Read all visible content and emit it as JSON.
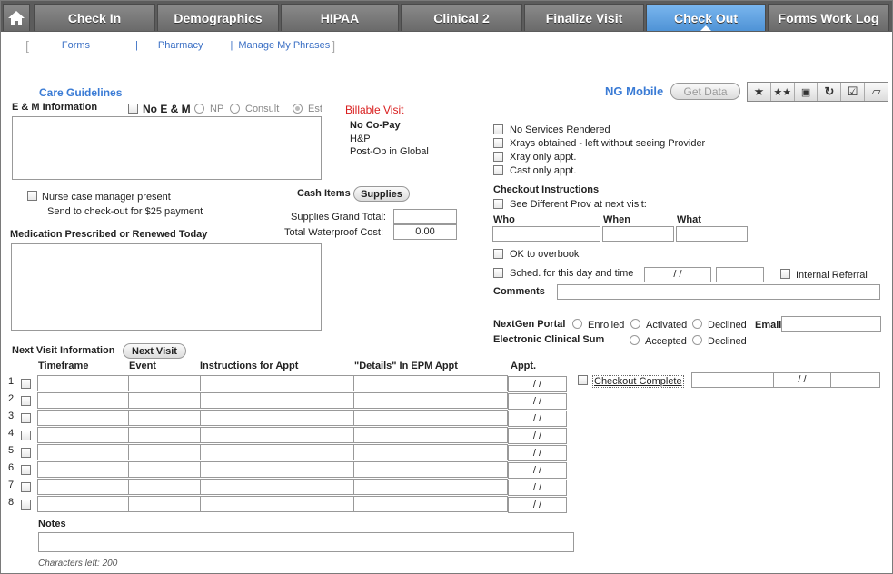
{
  "tabs": {
    "home_icon": "home-icon",
    "items": [
      "Check In",
      "Demographics",
      "HIPAA",
      "Clinical 2",
      "Finalize Visit",
      "Check Out",
      "Forms Work Log"
    ],
    "active": "Check Out"
  },
  "sublinks": [
    "Forms",
    "Pharmacy",
    "Manage My Phrases"
  ],
  "care_guidelines": "Care Guidelines",
  "em": {
    "title": "E & M Information",
    "no_em": "No E & M",
    "np": "NP",
    "consult": "Consult",
    "est": "Est"
  },
  "billable": {
    "title": "Billable Visit",
    "no_copay": "No Co-Pay",
    "hp": "H&P",
    "postop": "Post-Op in Global"
  },
  "nurse": {
    "label": "Nurse case manager present",
    "note": "Send to check-out for $25 payment"
  },
  "cash": {
    "label": "Cash Items",
    "supplies_btn": "Supplies",
    "supplies_total_label": "Supplies Grand Total:",
    "supplies_total_value": "",
    "waterproof_label": "Total Waterproof Cost:",
    "waterproof_value": "0.00"
  },
  "medication": {
    "title": "Medication Prescribed or Renewed Today"
  },
  "next_visit": {
    "title": "Next Visit Information",
    "button": "Next Visit",
    "columns": [
      "Timeframe",
      "Event",
      "Instructions for Appt",
      "\"Details\" In EPM Appt",
      "Appt."
    ],
    "rows": [
      "1",
      "2",
      "3",
      "4",
      "5",
      "6",
      "7",
      "8"
    ],
    "date_placeholder": "/ /"
  },
  "notes": {
    "title": "Notes",
    "chars_left": "Characters left: 200"
  },
  "ng_mobile": {
    "label": "NG Mobile",
    "get_data": "Get Data"
  },
  "toolbar_icons": [
    "star-icon",
    "double-star-icon",
    "save-icon",
    "refresh-icon",
    "clipboard-icon",
    "eraser-icon"
  ],
  "services": [
    "No Services Rendered",
    "Xrays obtained - left without seeing Provider",
    "Xray only appt.",
    "Cast only appt."
  ],
  "checkout_instr": {
    "title": "Checkout Instructions",
    "diff_prov": "See Different Prov at next visit:",
    "who": "Who",
    "when": "When",
    "what": "What",
    "overbook": "OK to overbook",
    "sched": "Sched. for this day and time",
    "sched_date": "/ /",
    "internal_referral": "Internal Referral",
    "comments": "Comments"
  },
  "portal": {
    "nextgen_portal": "NextGen Portal",
    "enrolled": "Enrolled",
    "activated": "Activated",
    "declined": "Declined",
    "email": "Email",
    "ecs": "Electronic Clinical Sum",
    "accepted": "Accepted",
    "declined2": "Declined"
  },
  "checkout_complete": {
    "label": "Checkout Complete",
    "date": "/ /"
  }
}
